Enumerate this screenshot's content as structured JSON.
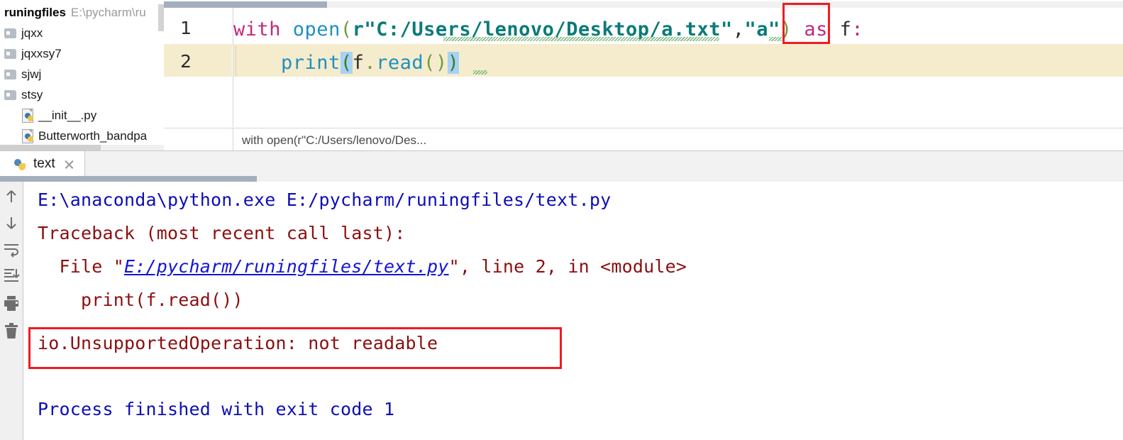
{
  "project_pane": {
    "header": {
      "project_name": "runingfiles",
      "project_path": "E:\\pycharm\\ru"
    },
    "items": [
      {
        "label": "jqxx",
        "icon": "folder-icon",
        "indent": 0
      },
      {
        "label": "jqxxsy7",
        "icon": "folder-icon",
        "indent": 0
      },
      {
        "label": "sjwj",
        "icon": "folder-icon",
        "indent": 0
      },
      {
        "label": "stsy",
        "icon": "folder-icon",
        "indent": 0
      },
      {
        "label": "__init__.py",
        "icon": "python-file-icon",
        "indent": 1
      },
      {
        "label": "Butterworth_bandpa",
        "icon": "python-file-icon",
        "indent": 1
      }
    ]
  },
  "editor": {
    "line_numbers": [
      "1",
      "2"
    ],
    "caret_line": 2,
    "code": {
      "line1": {
        "kw_with": "with",
        "space1": " ",
        "fn_open": "open",
        "paren_open": "(",
        "raw_string": "r\"C:/Users/lenovo/Desktop/a.txt\"",
        "comma": ",",
        "mode_arg": "\"a\"",
        "paren_close": ")",
        "space2": " ",
        "kw_as": "as",
        "space3": " ",
        "var_f": "f",
        "colon": ":"
      },
      "line2": {
        "indent": "    ",
        "fn_print": "print",
        "paren_open": "(",
        "var_f": "f",
        "dot": ".",
        "mth_read": "read",
        "paren_open2": "(",
        "paren_close2": ")",
        "paren_close": ")"
      }
    },
    "breadcrumb": "with open(r\"C:/Users/lenovo/Des...",
    "annotation_label": "mode-argument-highlight"
  },
  "console": {
    "tab": {
      "label": "text",
      "icon": "python-icon",
      "close_icon": "close-icon"
    },
    "toolbar": [
      {
        "name": "scroll-up-icon",
        "title": "Up the Stack Trace"
      },
      {
        "name": "scroll-down-icon",
        "title": "Down the Stack Trace"
      },
      {
        "name": "soft-wrap-icon",
        "title": "Soft-Wrap"
      },
      {
        "name": "scroll-to-end-icon",
        "title": "Scroll to End"
      },
      {
        "name": "print-icon",
        "title": "Print"
      },
      {
        "name": "trash-icon",
        "title": "Clear All"
      }
    ],
    "output": [
      {
        "id": "run-command",
        "color": "blue",
        "text": "E:\\anaconda\\python.exe E:/pycharm/runingfiles/text.py"
      },
      {
        "id": "traceback-header",
        "color": "red",
        "text": "Traceback (most recent call last):"
      },
      {
        "id": "traceback-frame",
        "color": "red",
        "prefix": "  File \"",
        "link": "E:/pycharm/runingfiles/text.py",
        "suffix": "\", line 2, in <module>"
      },
      {
        "id": "traceback-source",
        "color": "red",
        "text": "    print(f.read())"
      },
      {
        "id": "exception-message",
        "color": "red",
        "text": "io.UnsupportedOperation: not readable"
      },
      {
        "id": "process-exit",
        "color": "blue",
        "text": "Process finished with exit code 1"
      }
    ],
    "annotation_label": "exception-message-highlight"
  },
  "colors": {
    "annotation_red": "#EE1B24",
    "caret_line": "#F5ECCD",
    "console_blue": "#0E0EB4",
    "console_red": "#8B0F0F",
    "link_blue": "#1414D6",
    "keyword": "#C4287C",
    "function": "#2090C0",
    "string": "#0B7B78",
    "paren_match": "#A6D2F4"
  }
}
